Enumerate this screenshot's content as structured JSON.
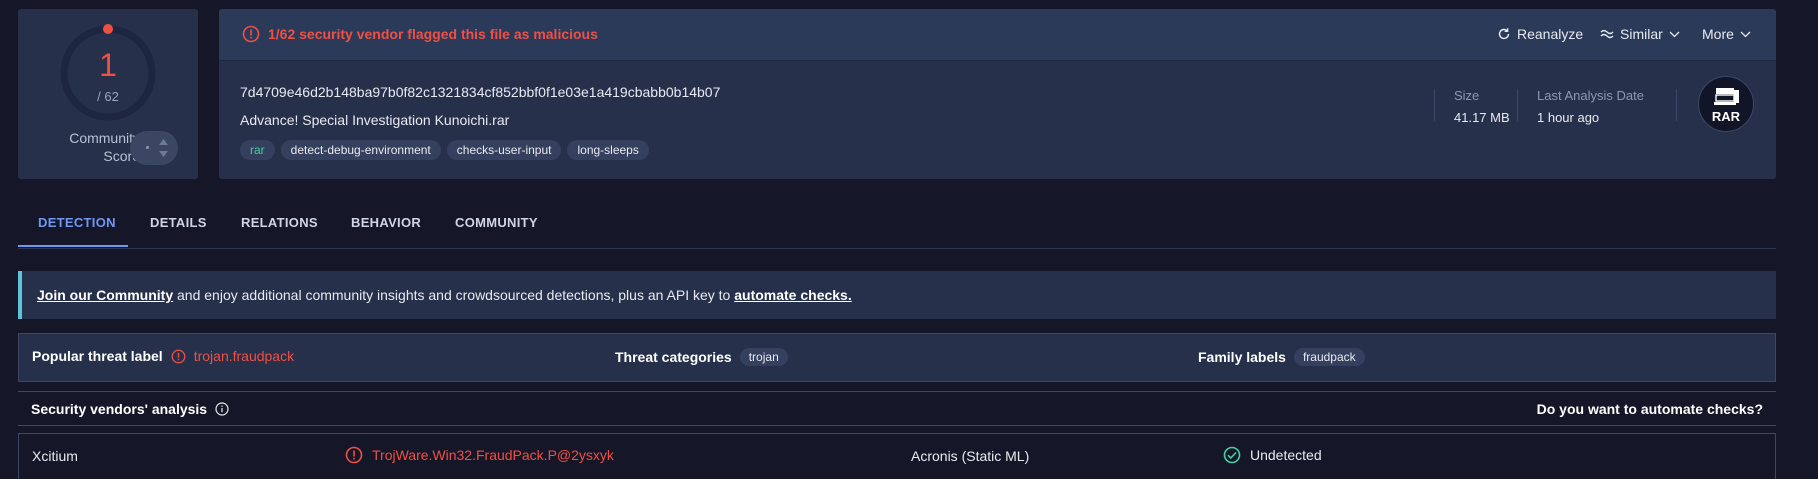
{
  "score": {
    "detections": "1",
    "total": "/ 62",
    "community_label": "Community Score",
    "community_value": "-"
  },
  "alert": {
    "text": "1/62 security vendor flagged this file as malicious",
    "reanalyze": "Reanalyze",
    "similar": "Similar",
    "more": "More"
  },
  "file": {
    "hash": "7d4709e46d2b148ba97b0f82c1321834cf852bbf0f1e03e1a419cbabb0b14b07",
    "name": "Advance! Special Investigation Kunoichi.rar",
    "tags": [
      "rar",
      "detect-debug-environment",
      "checks-user-input",
      "long-sleeps"
    ],
    "size_label": "Size",
    "size_value": "41.17 MB",
    "date_label": "Last Analysis Date",
    "date_value": "1 hour ago",
    "type_badge": "RAR"
  },
  "tabs": [
    {
      "label": "DETECTION",
      "active": true
    },
    {
      "label": "DETAILS",
      "active": false
    },
    {
      "label": "RELATIONS",
      "active": false
    },
    {
      "label": "BEHAVIOR",
      "active": false
    },
    {
      "label": "COMMUNITY",
      "active": false
    }
  ],
  "banner": {
    "link1": "Join our Community",
    "middle": " and enjoy additional community insights and crowdsourced detections, plus an API key to ",
    "link2": "automate checks."
  },
  "threat": {
    "popular_label": "Popular threat label",
    "popular_value": "trojan.fraudpack",
    "categories_label": "Threat categories",
    "categories_value": "trojan",
    "family_label": "Family labels",
    "family_value": "fraudpack"
  },
  "vendors": {
    "title": "Security vendors' analysis",
    "automate_question": "Do you want to automate checks?",
    "rows": [
      {
        "vendor1": "Xcitium",
        "result1": "TrojWare.Win32.FraudPack.P@2ysxyk",
        "vendor2": "Acronis (Static ML)",
        "result2": "Undetected"
      }
    ]
  },
  "colors": {
    "malicious": "#f04f43",
    "accent": "#6e97f2",
    "undetected": "#3fd1a2",
    "background": "#151729",
    "card": "#26304a"
  }
}
